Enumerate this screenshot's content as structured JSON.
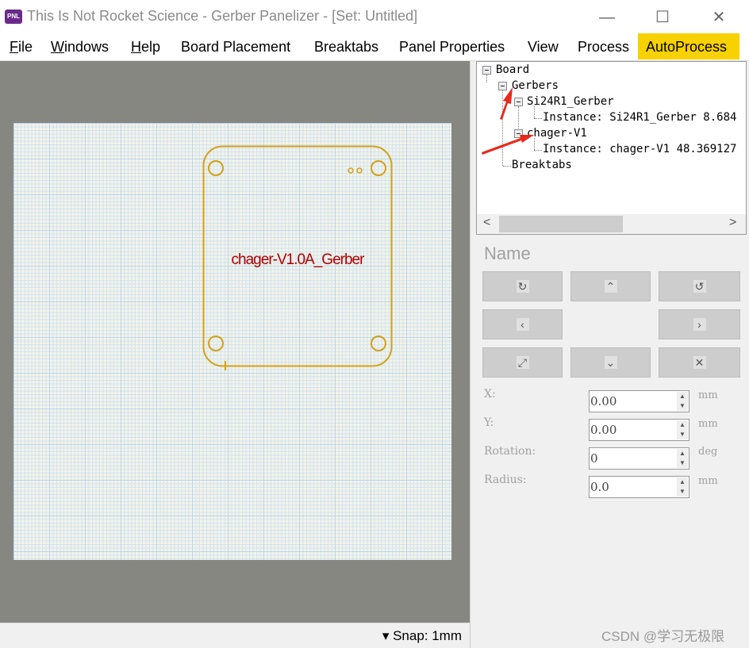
{
  "window": {
    "title": "This Is Not Rocket Science - Gerber Panelizer - [Set: Untitled]",
    "logo": "PNL",
    "minimize": "—",
    "maximize": "☐",
    "close": "✕"
  },
  "menu": [
    {
      "label": "File",
      "accel": "F",
      "rest": "ile"
    },
    {
      "label": "Windows",
      "accel": "W",
      "rest": "indows"
    },
    {
      "label": "Help",
      "accel": "H",
      "rest": "elp"
    },
    {
      "label": "Board Placement"
    },
    {
      "label": "Breaktabs"
    },
    {
      "label": "Panel Properties"
    },
    {
      "label": "View"
    },
    {
      "label": "Process"
    },
    {
      "label": "AutoProcess"
    }
  ],
  "colors": {
    "autoprocess_bg": "#f7d100",
    "board_bg": "#f5f3e6",
    "grid": "#b9d6ee",
    "outline": "#d4a017",
    "label": "#b00000",
    "canvas": "#878782"
  },
  "canvas": {
    "board_label": "chager-V1.0A_Gerber"
  },
  "tree": {
    "board": "Board",
    "gerbers": "Gerbers",
    "g1": "Si24R1_Gerber",
    "g1_instance": "Instance: Si24R1_Gerber 8.684",
    "g2": "chager-V1",
    "g2_instance": "Instance: chager-V1 48.369127",
    "breaktabs": "Breaktabs"
  },
  "props": {
    "name": "Name",
    "buttons": [
      {
        "icon": "rotate-cw-icon",
        "glyph": "↻"
      },
      {
        "icon": "move-up-icon",
        "glyph": "⌃"
      },
      {
        "icon": "rotate-ccw-icon",
        "glyph": "↺"
      },
      {
        "icon": "move-left-icon",
        "glyph": "‹"
      },
      {
        "icon": "move-right-icon",
        "glyph": "›"
      },
      {
        "icon": "expand-icon",
        "glyph": "⤢"
      },
      {
        "icon": "move-down-icon",
        "glyph": "⌄"
      },
      {
        "icon": "shrink-icon",
        "glyph": "✕"
      }
    ],
    "fields": [
      {
        "label": "X:",
        "value": "0.00",
        "unit": "mm"
      },
      {
        "label": "Y:",
        "value": "0.00",
        "unit": "mm"
      },
      {
        "label": "Rotation:",
        "value": "0",
        "unit": "deg"
      },
      {
        "label": "Radius:",
        "value": "0.0",
        "unit": "mm"
      }
    ]
  },
  "status": {
    "snap": "▾ Snap: 1mm"
  },
  "watermark": "CSDN @学习无极限"
}
